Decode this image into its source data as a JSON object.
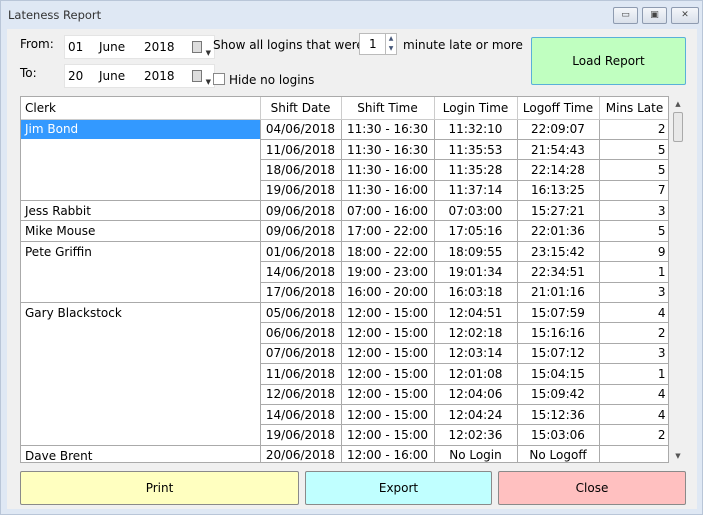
{
  "window": {
    "title": "Lateness Report",
    "minimize": "▭",
    "maximize": "▣",
    "close": "✕"
  },
  "filters": {
    "from_label": "From:",
    "from_day": "01",
    "from_month": "June",
    "from_year": "2018",
    "to_label": "To:",
    "to_day": "20",
    "to_month": "June",
    "to_year": "2018",
    "show_label": "Show all logins that were",
    "minutes_value": "1",
    "minutes_suffix": "minute late or more",
    "hide_label": "Hide no logins",
    "hide_checked": false
  },
  "load_button": "Load Report",
  "table": {
    "columns": [
      "Clerk",
      "Shift Date",
      "Shift Time",
      "Login Time",
      "Logoff Time",
      "Mins Late"
    ],
    "rows": [
      [
        "Jim Bond",
        "04/06/2018",
        "11:30 - 16:30",
        "11:32:10",
        "22:09:07",
        "2"
      ],
      [
        "",
        "11/06/2018",
        "11:30 - 16:30",
        "11:35:53",
        "21:54:43",
        "5"
      ],
      [
        "",
        "18/06/2018",
        "11:30 - 16:00",
        "11:35:28",
        "22:14:28",
        "5"
      ],
      [
        "",
        "19/06/2018",
        "11:30 - 16:00",
        "11:37:14",
        "16:13:25",
        "7"
      ],
      [
        "Jess Rabbit",
        "09/06/2018",
        "07:00 - 16:00",
        "07:03:00",
        "15:27:21",
        "3"
      ],
      [
        "Mike Mouse",
        "09/06/2018",
        "17:00 - 22:00",
        "17:05:16",
        "22:01:36",
        "5"
      ],
      [
        "Pete Griffin",
        "01/06/2018",
        "18:00 - 22:00",
        "18:09:55",
        "23:15:42",
        "9"
      ],
      [
        "",
        "14/06/2018",
        "19:00 - 23:00",
        "19:01:34",
        "22:34:51",
        "1"
      ],
      [
        "",
        "17/06/2018",
        "16:00 - 20:00",
        "16:03:18",
        "21:01:16",
        "3"
      ],
      [
        "Gary Blackstock",
        "05/06/2018",
        "12:00 - 15:00",
        "12:04:51",
        "15:07:59",
        "4"
      ],
      [
        "",
        "06/06/2018",
        "12:00 - 15:00",
        "12:02:18",
        "15:16:16",
        "2"
      ],
      [
        "",
        "07/06/2018",
        "12:00 - 15:00",
        "12:03:14",
        "15:07:12",
        "3"
      ],
      [
        "",
        "11/06/2018",
        "12:00 - 15:00",
        "12:01:08",
        "15:04:15",
        "1"
      ],
      [
        "",
        "12/06/2018",
        "12:00 - 15:00",
        "12:04:06",
        "15:09:42",
        "4"
      ],
      [
        "",
        "14/06/2018",
        "12:00 - 15:00",
        "12:04:24",
        "15:12:36",
        "4"
      ],
      [
        "",
        "19/06/2018",
        "12:00 - 15:00",
        "12:02:36",
        "15:03:06",
        "2"
      ],
      [
        "Dave Brent",
        "20/06/2018",
        "12:00 - 16:00",
        "No Login",
        "No Logoff",
        ""
      ]
    ]
  },
  "buttons": {
    "print": "Print",
    "export": "Export",
    "close": "Close"
  },
  "colors": {
    "load": "#c0ffc0",
    "print": "#ffffc0",
    "export": "#c0ffff",
    "close": "#ffc0c0",
    "selection": "#3399ff"
  }
}
